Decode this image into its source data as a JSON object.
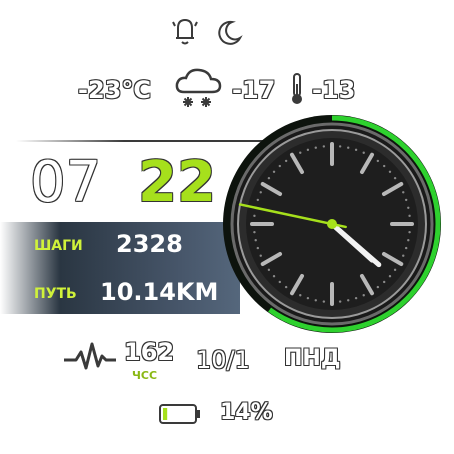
{
  "status_icons": [
    "bell-off-icon",
    "moon-icon"
  ],
  "weather": {
    "current_temp": "-23°C",
    "icon": "snow-cloud-icon",
    "high_temp": "-17",
    "low_temp": "-13",
    "thermometer_icon": "thermometer-icon"
  },
  "time": {
    "hours": "07",
    "minutes": "22",
    "accent_color": "#a6e01c"
  },
  "stats": {
    "steps_label": "ШАГИ",
    "steps_value": "2328",
    "distance_label": "ПУТЬ",
    "distance_value": "10.14KM"
  },
  "analog_clock": {
    "hour": 4,
    "minute": 22,
    "second": 47,
    "progress_ring_fraction": 0.6,
    "ring_color": "#2ed12e"
  },
  "heart_rate": {
    "value": "162",
    "label": "ЧСС",
    "icon": "heartbeat-icon"
  },
  "date": {
    "day_month": "10/1",
    "weekday": "ПНД"
  },
  "battery": {
    "percent_text": "14%",
    "level": 0.14,
    "icon": "battery-icon"
  }
}
